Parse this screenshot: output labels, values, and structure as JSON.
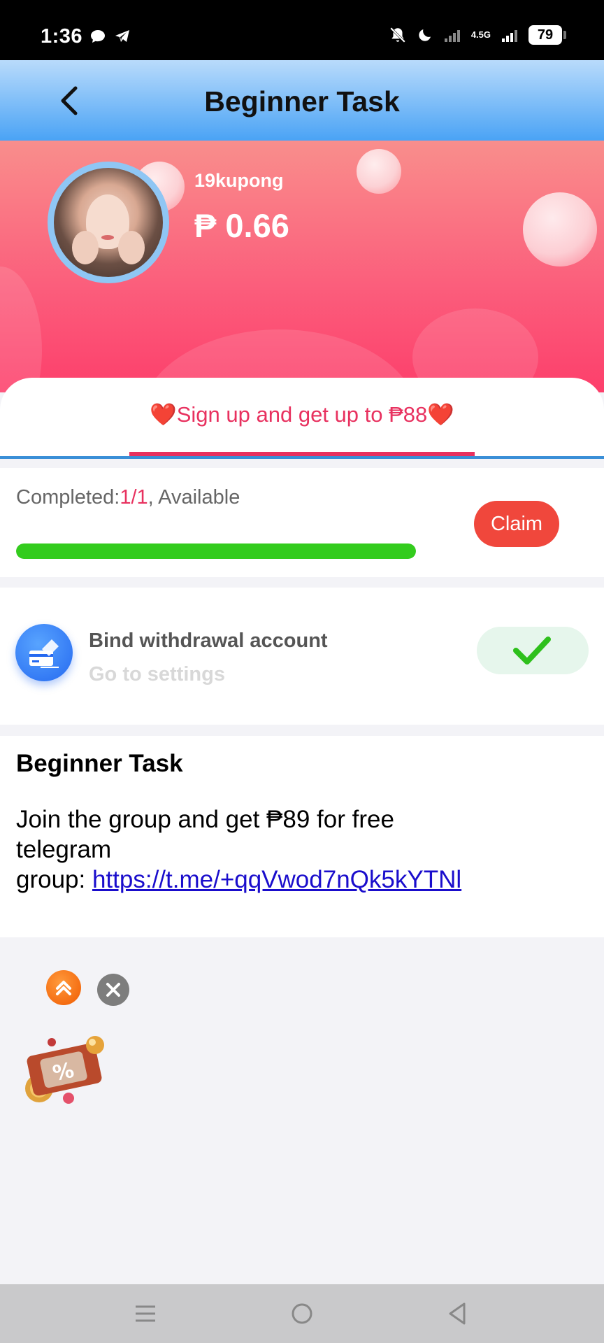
{
  "status_bar": {
    "time": "1:36",
    "network": "4.5G",
    "battery": "79",
    "icons": [
      "chat-icon",
      "telegram-icon",
      "mute-icon",
      "moon-icon",
      "signal-icon",
      "signal-icon"
    ]
  },
  "header": {
    "title": "Beginner Task",
    "back_icon": "chevron-left-icon"
  },
  "profile": {
    "username": "19kupong",
    "balance": "₱ 0.66"
  },
  "tab": {
    "label": "❤️Sign up and get up to ₱88❤️"
  },
  "progress": {
    "completed_prefix": "Completed:",
    "completed_count": "1/1",
    "completed_suffix": ", Available",
    "fraction": 1.0,
    "claim_label": "Claim"
  },
  "task": {
    "title": "Bind withdrawal account",
    "subtitle": "Go to settings",
    "icon": "card-icon",
    "status_icon": "checkmark-icon"
  },
  "info": {
    "title": "Beginner Task",
    "line1": "Join the group and get ₱89 for free",
    "line2": "telegram",
    "line3_prefix": "group: ",
    "link": "https://t.me/+qqVwod7nQk5kYTNl"
  },
  "floating": {
    "up_icon": "double-chevron-up-icon",
    "close_icon": "close-icon",
    "coupon_icon": "coupon-icon",
    "coupon_symbol": "%"
  },
  "colors": {
    "accent": "#e8315f",
    "claim": "#f0473c",
    "progress": "#33cc1d",
    "header_top": "#b9dbfb",
    "header_bottom": "#4aa3f5",
    "link": "#1a0dcc"
  }
}
